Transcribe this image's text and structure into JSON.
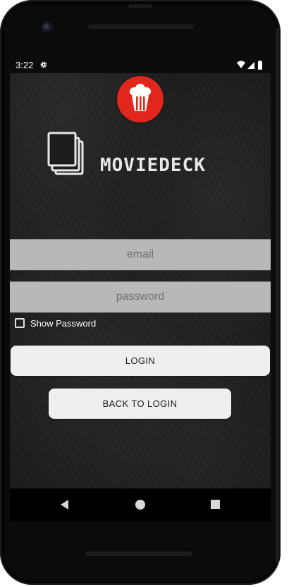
{
  "status_bar": {
    "time": "3:22",
    "icons": [
      "gear-icon",
      "wifi-icon",
      "signal-icon",
      "battery-icon"
    ]
  },
  "app": {
    "logo": "popcorn-icon",
    "brand_name": "MOVIEDECK",
    "accent_color": "#e1261c"
  },
  "form": {
    "email_placeholder": "email",
    "email_value": "",
    "password_placeholder": "password",
    "password_value": "",
    "show_password_label": "Show Password",
    "show_password_checked": false,
    "login_label": "LOGIN",
    "back_label": "BACK TO LOGIN"
  },
  "nav": {
    "icons": [
      "back-icon",
      "home-icon",
      "recents-icon"
    ]
  }
}
